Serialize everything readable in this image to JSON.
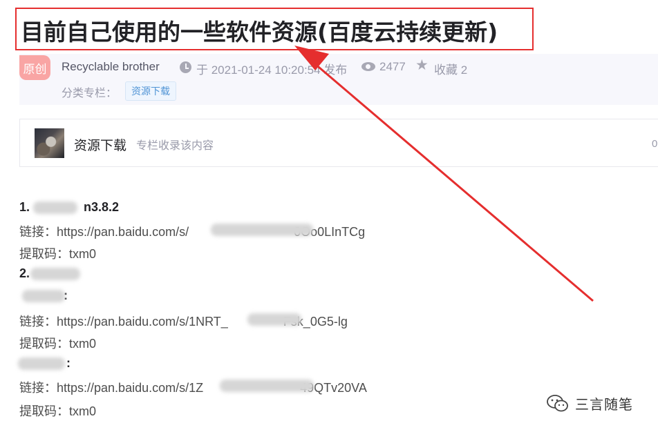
{
  "article": {
    "title": "目前自己使用的一些软件资源(百度云持续更新)",
    "badge": "原创",
    "author": "Recyclable brother",
    "published": "于 2021-01-24 10:20:54 发布",
    "views": "2477",
    "collect": "收藏 2",
    "category_label": "分类专栏：",
    "category_tag": "资源下载"
  },
  "column": {
    "name": "资源下载",
    "desc": "专栏收录该内容",
    "count": "0"
  },
  "content": {
    "line1": "1.",
    "line1_tail": "n3.8.2",
    "link1_prefix": "链接：https://pan.baidu.com/s/",
    "link1_tail": "0Oo0LInTCg",
    "code1": "提取码：txm0",
    "line2": "2.",
    "line3_tail": ":",
    "link2_prefix": "链接：https://pan.baidu.com/s/1NRT_",
    "link2_tail": "Fsk_0G5-lg",
    "code2": "提取码：txm0",
    "line4_tail": ":",
    "link3_prefix": "链接：https://pan.baidu.com/s/1Z",
    "link3_tail": "49QTv20VA",
    "code3": "提取码：txm0"
  },
  "watermark": {
    "text": "三言随笔",
    "icon": "wechat-icon"
  },
  "colors": {
    "annotation_red": "#e52e2e",
    "tag_blue": "#5094d5",
    "badge_pink": "#f9a5a4"
  }
}
